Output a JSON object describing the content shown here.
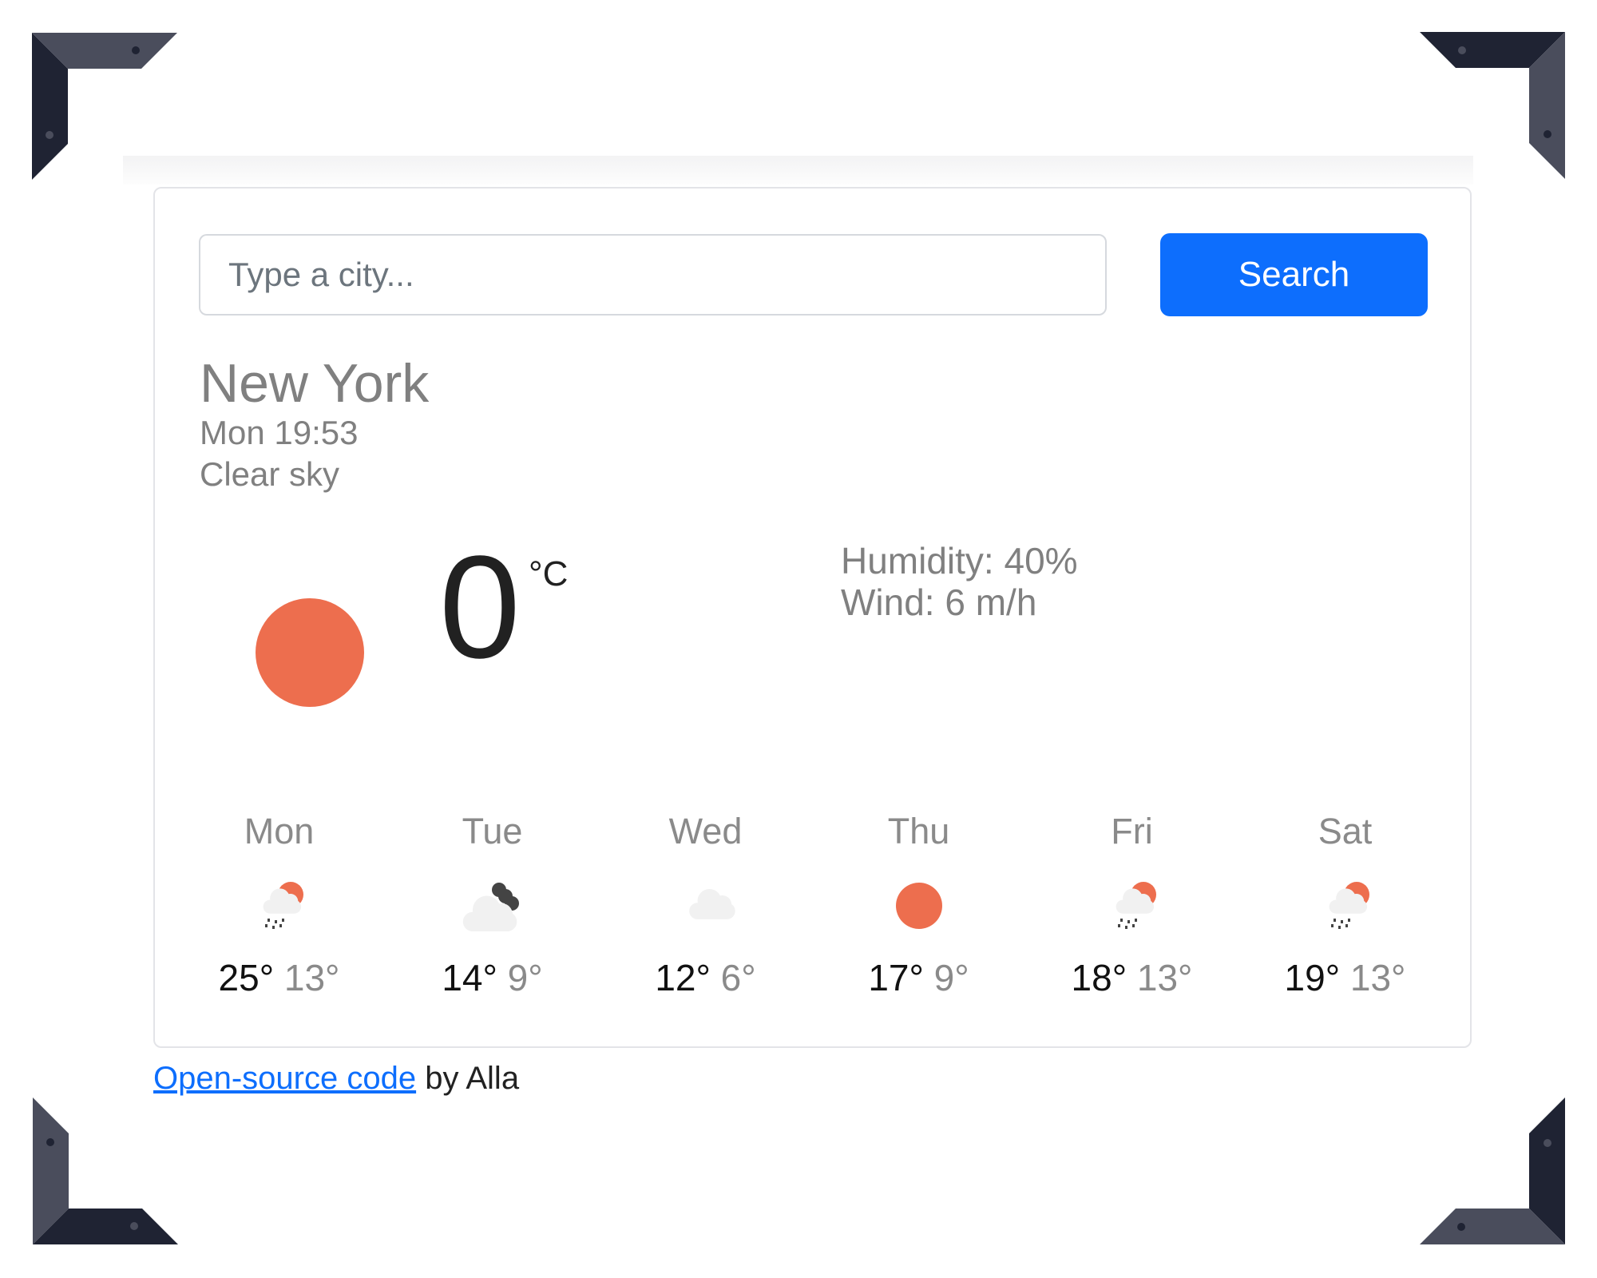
{
  "search": {
    "placeholder": "Type a city...",
    "value": "",
    "button_label": "Search"
  },
  "current": {
    "city": "New York",
    "datetime": "Mon 19:53",
    "description": "Clear sky",
    "icon": "sun-icon",
    "temperature": "0",
    "unit": "°C",
    "humidity_label": "Humidity: 40%",
    "wind_label": "Wind: 6 m/h",
    "humidity_percent": 40,
    "wind_speed": 6
  },
  "forecast": [
    {
      "day": "Mon",
      "icon": "rain-sun-icon",
      "max": "25°",
      "min": "13°"
    },
    {
      "day": "Tue",
      "icon": "cloud-dark-icon",
      "max": "14°",
      "min": "9°"
    },
    {
      "day": "Wed",
      "icon": "cloud-icon",
      "max": "12°",
      "min": "6°"
    },
    {
      "day": "Thu",
      "icon": "sun-icon",
      "max": "17°",
      "min": "9°"
    },
    {
      "day": "Fri",
      "icon": "rain-sun-icon",
      "max": "18°",
      "min": "13°"
    },
    {
      "day": "Sat",
      "icon": "rain-sun-icon",
      "max": "19°",
      "min": "13°"
    }
  ],
  "footer": {
    "link_text": "Open-source code",
    "suffix": " by Alla"
  },
  "colors": {
    "accent": "#0d6efd",
    "sun": "#ed6e4e",
    "cloud": "#f1f1f1",
    "dark_cloud": "#444444",
    "corner_dark": "#1f2333",
    "corner_light": "#4a4d5c"
  }
}
